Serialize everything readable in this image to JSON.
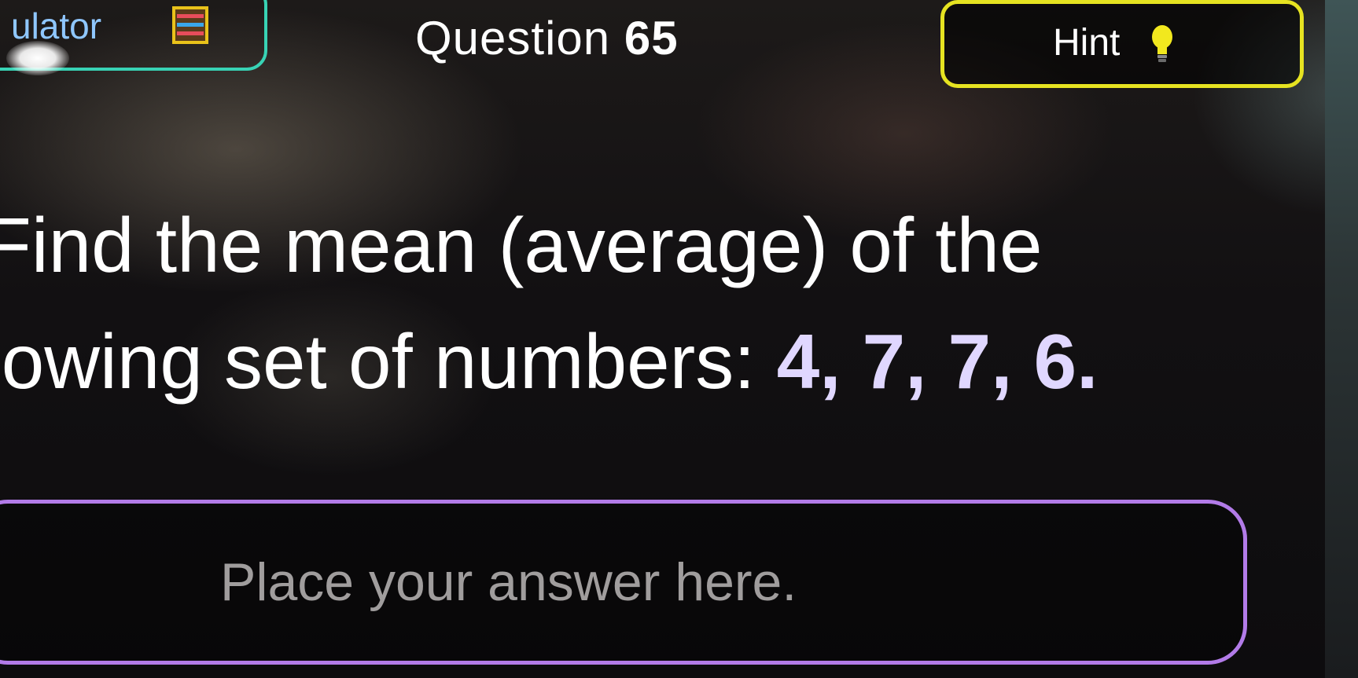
{
  "calculator": {
    "label": "ulator",
    "icon": "abacus-icon"
  },
  "question": {
    "prefix": "Question ",
    "number": "65"
  },
  "hint": {
    "label": "Hint",
    "icon": "lightbulb-icon"
  },
  "prompt": {
    "line1": "Find the mean (average) of the",
    "line2_text": "lowing set of numbers: ",
    "line2_numbers": "4, 7, 7, 6."
  },
  "answer": {
    "placeholder": "Place your answer here.",
    "value": ""
  },
  "colors": {
    "calculator_border": "#38d3b5",
    "hint_border": "#e6e321",
    "answer_border": "#b27be8",
    "background": "#0c0b0d"
  }
}
